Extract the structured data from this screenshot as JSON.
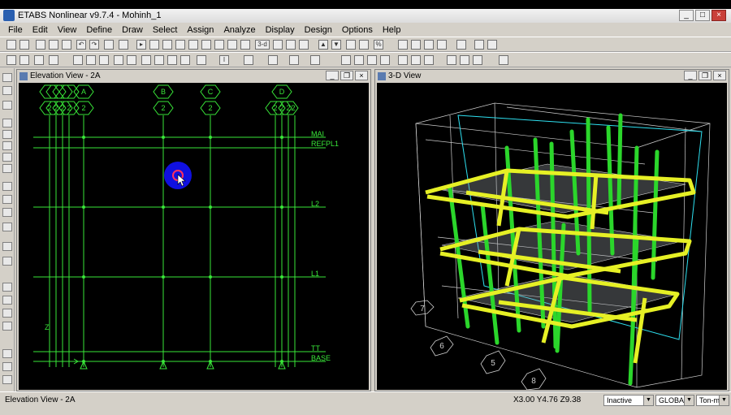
{
  "app": {
    "title": "ETABS Nonlinear v9.7.4 - Mohinh_1"
  },
  "menu": [
    "File",
    "Edit",
    "View",
    "Define",
    "Draw",
    "Select",
    "Assign",
    "Analyze",
    "Display",
    "Design",
    "Options",
    "Help"
  ],
  "toolbar": {
    "threed_label": "3-d"
  },
  "elevation_view": {
    "title": "Elevation View - 2A",
    "grid_bubbles": [
      "A",
      "B",
      "C",
      "D"
    ],
    "bubble_number": "2",
    "story_labels": [
      "MAI",
      "REFPL1",
      "L2",
      "L1",
      "TT",
      "BASE"
    ],
    "axis_label": "Z"
  },
  "view3d": {
    "title": "3-D View",
    "bubble_labels": [
      "7",
      "6",
      "5",
      "8"
    ]
  },
  "status": {
    "left": "Elevation View - 2A",
    "coords": "X3.00  Y4.76  Z9.38",
    "inactive_select": "Inactive",
    "coord_system_select": "GLOBAL",
    "units_select": "Ton-m"
  },
  "colors": {
    "grid_green": "#39e639",
    "column_green": "#2bd62b",
    "beam_yellow": "#e6f025",
    "cursor_blue": "#1010e0"
  }
}
